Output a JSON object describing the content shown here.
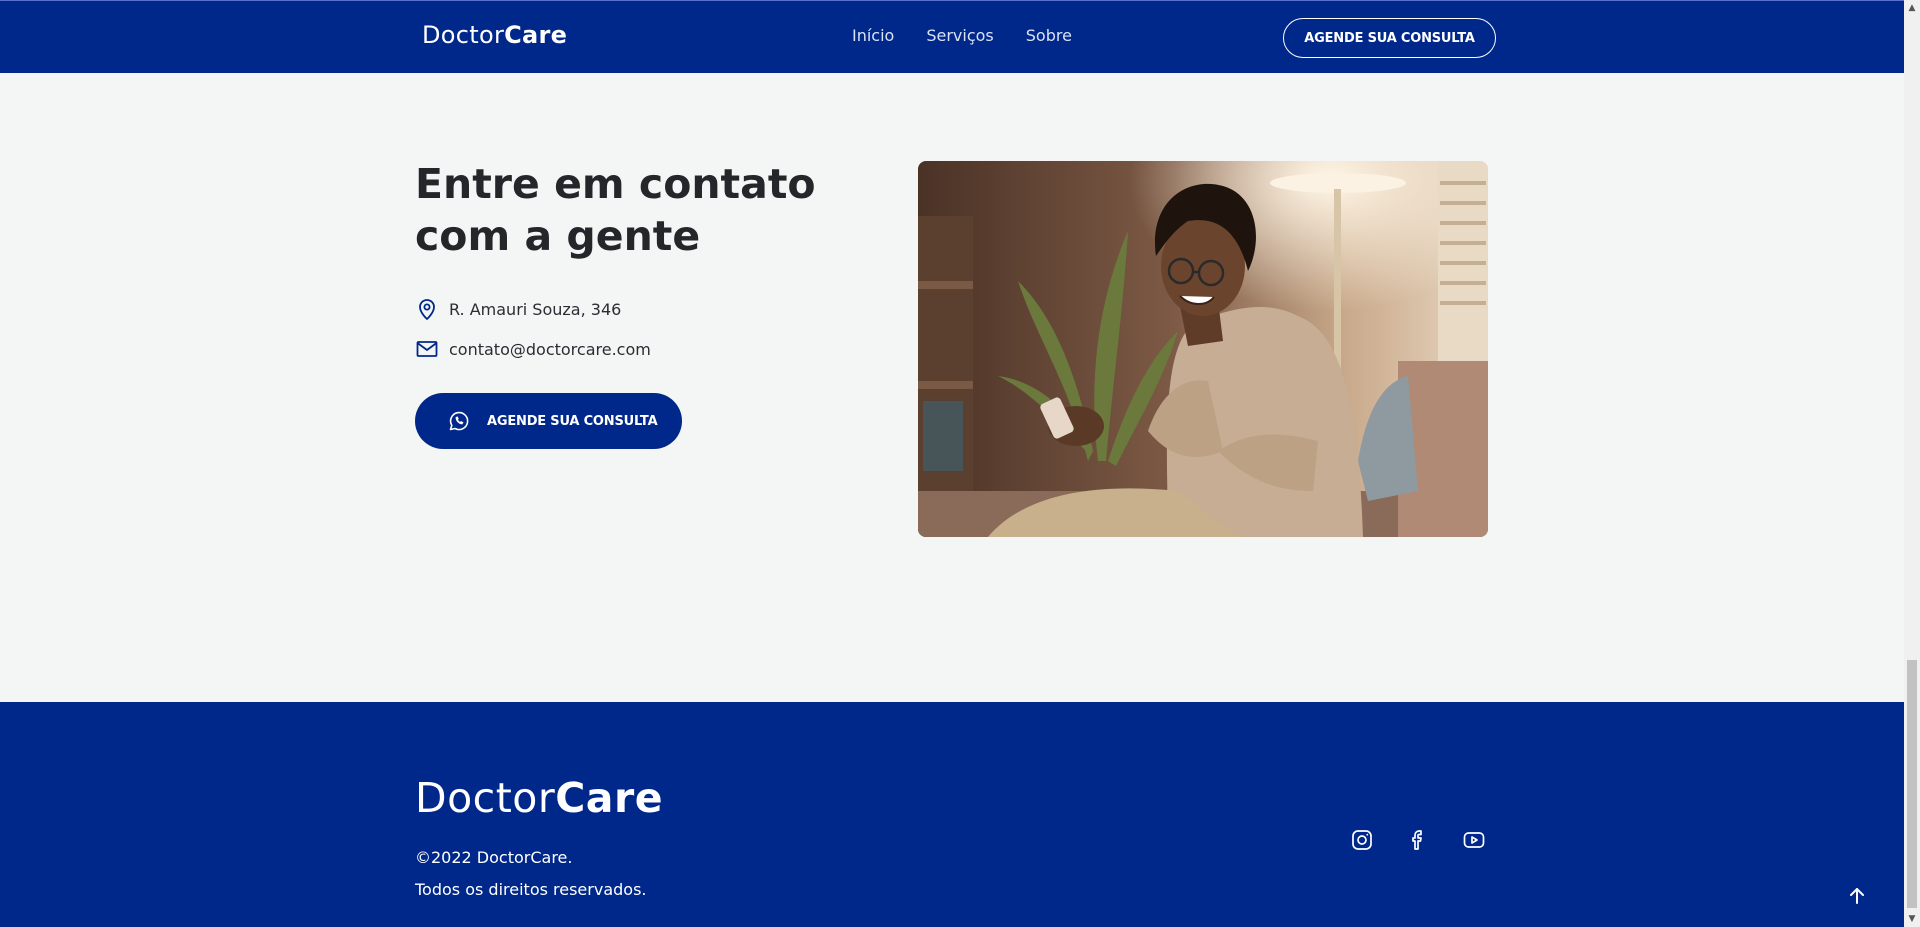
{
  "nav": {
    "logo_regular": "Doctor",
    "logo_bold": "Care",
    "links": [
      "Início",
      "Serviços",
      "Sobre"
    ],
    "cta_label": "AGENDE SUA CONSULTA"
  },
  "contact": {
    "title_line1": "Entre em contato",
    "title_line2": "com a gente",
    "address": "R. Amauri Souza, 346",
    "email": "contato@doctorcare.com",
    "cta_label": "AGENDE SUA CONSULTA",
    "icons": {
      "address": "map-pin-icon",
      "email": "mail-icon",
      "cta": "whatsapp-icon"
    }
  },
  "footer": {
    "logo_regular": "Doctor",
    "logo_bold": "Care",
    "copyright": "©2022 DoctorCare.",
    "rights": "Todos os direitos reservados.",
    "socials": [
      "instagram-icon",
      "facebook-icon",
      "youtube-icon"
    ],
    "back_to_top_icon": "arrow-up-icon"
  },
  "colors": {
    "brand": "#00288a",
    "background": "#f4f6f5",
    "heading": "#24262a"
  }
}
